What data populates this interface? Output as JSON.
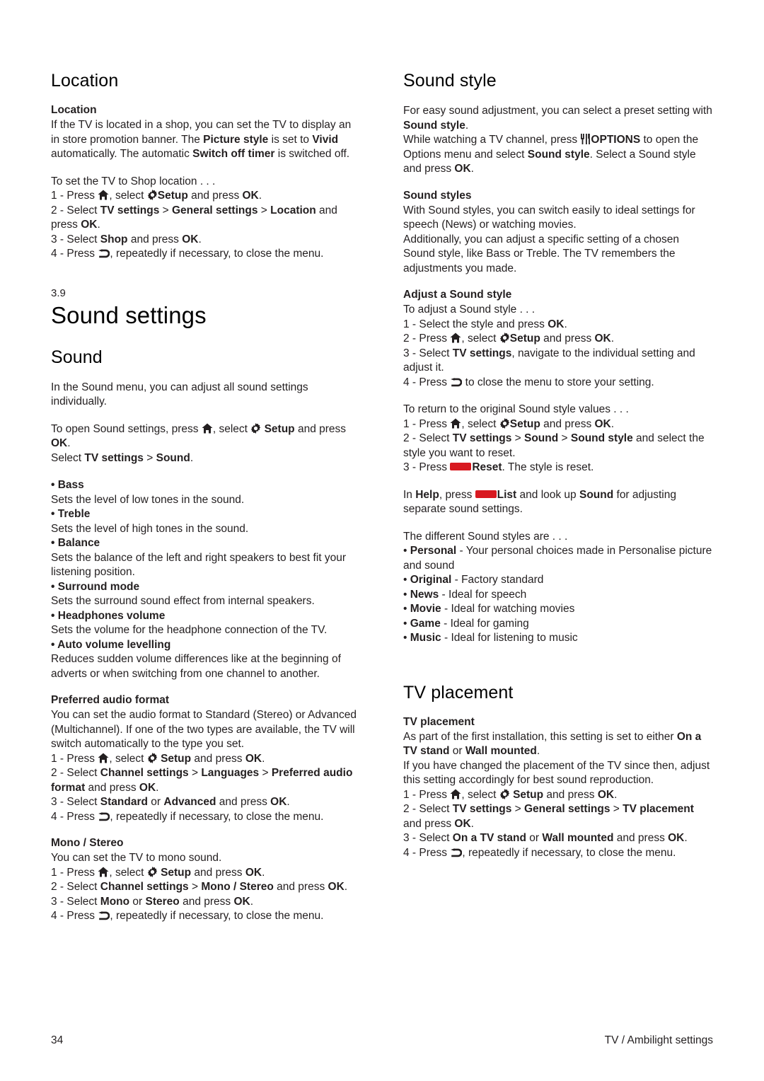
{
  "page": {
    "number": "34",
    "footer_title": "TV / Ambilight settings"
  },
  "left_column": {
    "location_heading": "Location",
    "location_sub": "Location",
    "location_p1_a": "If the TV is located in a shop, you can set the TV to display an in store promotion banner. The ",
    "location_p1_b": "Picture style",
    "location_p1_c": " is set to ",
    "location_p1_d": "Vivid",
    "location_p1_e": " automatically. The automatic ",
    "location_p1_f": "Switch off timer",
    "location_p1_g": " is switched off.",
    "location_p2": "To set the TV to Shop location . . .",
    "location_step1_a": "1 - Press ",
    "location_step1_b": ", select ",
    "location_step1_c": "Setup",
    "location_step1_d": " and press ",
    "location_step1_e": "OK",
    "location_step1_f": ".",
    "location_step2_a": "2 - Select ",
    "location_step2_b": "TV settings",
    "location_step2_c": " > ",
    "location_step2_d": "General settings",
    "location_step2_e": " > ",
    "location_step2_f": "Location",
    "location_step2_g": " and press ",
    "location_step2_h": "OK",
    "location_step2_i": ".",
    "location_step3_a": "3 - Select ",
    "location_step3_b": "Shop",
    "location_step3_c": " and press ",
    "location_step3_d": "OK",
    "location_step3_e": ".",
    "location_step4_a": "4 - Press ",
    "location_step4_b": ", repeatedly if necessary, to close the menu.",
    "chapter_number": "3.9",
    "chapter_title": "Sound settings",
    "sound_heading": "Sound",
    "sound_p1": "In the Sound menu, you can adjust all sound settings individually.",
    "sound_p2_a": "To open Sound settings, press ",
    "sound_p2_b": ", select ",
    "sound_p2_c": "Setup",
    "sound_p2_d": " and press ",
    "sound_p2_e": "OK",
    "sound_p2_f": ".",
    "sound_p3_a": "Select ",
    "sound_p3_b": "TV settings",
    "sound_p3_c": " > ",
    "sound_p3_d": "Sound",
    "sound_p3_e": ".",
    "items": [
      {
        "label": "• Bass",
        "desc": "Sets the level of low tones in the sound."
      },
      {
        "label": "• Treble",
        "desc": "Sets the level of high tones in the sound."
      },
      {
        "label": "• Balance",
        "desc": "Sets the balance of the left and right speakers to best fit your listening position."
      },
      {
        "label": "• Surround mode",
        "desc": "Sets the surround sound effect from internal speakers."
      },
      {
        "label": "• Headphones volume",
        "desc": "Sets the volume for the headphone connection of the TV."
      },
      {
        "label": "• Auto volume levelling",
        "desc": "Reduces sudden volume differences like at the beginning of adverts or when switching from one channel to another."
      }
    ],
    "paf_sub": "Preferred audio format",
    "paf_p1": "You can set the audio format to Standard (Stereo) or Advanced (Multichannel). If one of the two types are available, the TV will switch automatically to the type you set.",
    "paf_step1_a": "1 - Press ",
    "paf_step1_b": ", select ",
    "paf_step1_c": "Setup",
    "paf_step1_d": " and press ",
    "paf_step1_e": "OK",
    "paf_step1_f": ".",
    "paf_step2_a": "2 - Select ",
    "paf_step2_b": "Channel settings",
    "paf_step2_c": " > ",
    "paf_step2_d": "Languages",
    "paf_step2_e": " > ",
    "paf_step2_f": "Preferred audio format",
    "paf_step2_g": " and press ",
    "paf_step2_h": "OK",
    "paf_step2_i": ".",
    "paf_step3_a": "3 - Select ",
    "paf_step3_b": "Standard",
    "paf_step3_c": " or ",
    "paf_step3_d": "Advanced",
    "paf_step3_e": " and press ",
    "paf_step3_f": "OK",
    "paf_step3_g": ".",
    "paf_step4_a": "4 - Press ",
    "paf_step4_b": ", repeatedly if necessary, to close the menu.",
    "mono_sub": "Mono / Stereo",
    "mono_p1": "You can set the TV to mono sound.",
    "mono_step1_a": "1 - Press ",
    "mono_step1_b": ", select ",
    "mono_step1_c": "Setup",
    "mono_step1_d": " and press ",
    "mono_step1_e": "OK",
    "mono_step1_f": ".",
    "mono_step2_a": "2 - Select ",
    "mono_step2_b": "Channel settings",
    "mono_step2_c": " > ",
    "mono_step2_d": "Mono / Stereo",
    "mono_step2_e": " and press ",
    "mono_step2_f": "OK",
    "mono_step2_g": ".",
    "mono_step3_a": "3 - Select ",
    "mono_step3_b": "Mono",
    "mono_step3_c": " or ",
    "mono_step3_d": "Stereo",
    "mono_step3_e": " and press ",
    "mono_step3_f": "OK",
    "mono_step3_g": ".",
    "mono_step4_a": "4 - Press ",
    "mono_step4_b": ", repeatedly if necessary, to close the menu."
  },
  "right_column": {
    "soundstyle_heading": "Sound style",
    "ss_p1_a": "For easy sound adjustment, you can select a preset setting with ",
    "ss_p1_b": "Sound style",
    "ss_p1_c": ".",
    "ss_p2_a": "While watching a TV channel, press ",
    "ss_p2_b": "OPTIONS",
    "ss_p2_c": " to open the Options menu and select ",
    "ss_p2_d": "Sound style",
    "ss_p2_e": ". Select a Sound style and press ",
    "ss_p2_f": "OK",
    "ss_p2_g": ".",
    "ss_styles_sub": "Sound styles",
    "ss_styles_p1": "With Sound styles, you can switch easily to ideal settings for speech (News) or watching movies.",
    "ss_styles_p2": "Additionally, you can adjust a specific setting of a chosen Sound style, like Bass or Treble. The TV remembers the adjustments you made.",
    "adjust_sub": "Adjust a Sound style",
    "adjust_p1": "To adjust a Sound style . . .",
    "adjust_step1_a": "1 - Select the style and press ",
    "adjust_step1_b": "OK",
    "adjust_step1_c": ".",
    "adjust_step2_a": "2 - Press ",
    "adjust_step2_b": ", select ",
    "adjust_step2_c": "Setup",
    "adjust_step2_d": " and press ",
    "adjust_step2_e": "OK",
    "adjust_step2_f": ".",
    "adjust_step3_a": "3 - Select ",
    "adjust_step3_b": "TV settings",
    "adjust_step3_c": ", navigate to the individual setting and adjust it.",
    "adjust_step4_a": "4 - Press ",
    "adjust_step4_b": " to close the menu to store your setting.",
    "return_p1": "To return to the original Sound style values . . .",
    "return_step1_a": "1 - Press ",
    "return_step1_b": ", select ",
    "return_step1_c": "Setup",
    "return_step1_d": " and press ",
    "return_step1_e": "OK",
    "return_step1_f": ".",
    "return_step2_a": "2 - Select ",
    "return_step2_b": "TV settings",
    "return_step2_c": " > ",
    "return_step2_d": "Sound",
    "return_step2_e": " > ",
    "return_step2_f": "Sound style",
    "return_step2_g": " and select the style you want to reset.",
    "return_step3_a": "3 - Press ",
    "return_step3_b": "Reset",
    "return_step3_c": ". The style is reset.",
    "help_a": "In ",
    "help_b": "Help",
    "help_c": ", press ",
    "help_d": "List",
    "help_e": " and look up ",
    "help_f": "Sound",
    "help_g": " for adjusting separate sound settings.",
    "diff_p1": "The different Sound styles are . . .",
    "styles": [
      {
        "bullet": "• ",
        "name": "Personal",
        "desc": " - Your personal choices made in Personalise picture and sound"
      },
      {
        "bullet": "• ",
        "name": "Original",
        "desc": " - Factory standard"
      },
      {
        "bullet": "• ",
        "name": "News",
        "desc": " - Ideal for speech"
      },
      {
        "bullet": "• ",
        "name": "Movie",
        "desc": " - Ideal for watching movies"
      },
      {
        "bullet": "• ",
        "name": "Game",
        "desc": " - Ideal for gaming"
      },
      {
        "bullet": "• ",
        "name": "Music",
        "desc": " - Ideal for listening to music"
      }
    ],
    "tvplacement_heading": "TV placement",
    "tvp_sub": "TV placement",
    "tvp_p1_a": "As part of the first installation, this setting is set to either ",
    "tvp_p1_b": "On a TV stand",
    "tvp_p1_c": " or ",
    "tvp_p1_d": "Wall mounted",
    "tvp_p1_e": ".",
    "tvp_p2": "If you have changed the placement of the TV since then, adjust this setting accordingly for best sound reproduction.",
    "tvp_step1_a": "1 - Press ",
    "tvp_step1_b": ", select ",
    "tvp_step1_c": "Setup",
    "tvp_step1_d": " and press ",
    "tvp_step1_e": "OK",
    "tvp_step1_f": ".",
    "tvp_step2_a": "2 - Select ",
    "tvp_step2_b": "TV settings",
    "tvp_step2_c": " > ",
    "tvp_step2_d": "General settings",
    "tvp_step2_e": " > ",
    "tvp_step2_f": "TV placement",
    "tvp_step2_g": " and press ",
    "tvp_step2_h": "OK",
    "tvp_step2_i": ".",
    "tvp_step3_a": "3 - Select ",
    "tvp_step3_b": "On a TV stand",
    "tvp_step3_c": " or ",
    "tvp_step3_d": "Wall mounted",
    "tvp_step3_e": " and press ",
    "tvp_step3_f": "OK",
    "tvp_step3_g": ".",
    "tvp_step4_a": "4 - Press ",
    "tvp_step4_b": ", repeatedly if necessary, to close the menu."
  },
  "icons": {
    "home": "home-icon",
    "gear": "gear-icon",
    "back": "back-icon",
    "options": "options-icon",
    "red_key": "red-key-icon"
  },
  "colors": {
    "text": "#231f20",
    "red_key": "#d81920"
  }
}
